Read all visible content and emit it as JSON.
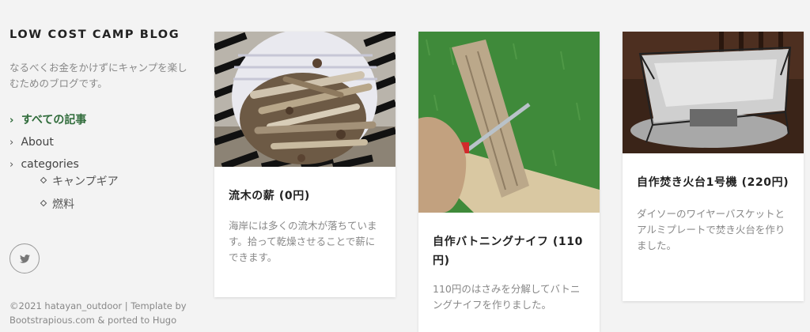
{
  "sidebar": {
    "site_title": "LOW COST CAMP BLOG",
    "description": "なるべくお金をかけずにキャンプを楽しむためのブログです。",
    "nav": {
      "all_posts": "すべての記事",
      "about": "About",
      "categories": "categories",
      "sub_items": [
        "キャンプギア",
        "燃料"
      ]
    },
    "social": {
      "icon": "twitter-icon"
    },
    "footer": {
      "line1": "©2021 hatayan_outdoor | Template by",
      "line2": "Bootstrapious.com & ported to Hugo"
    }
  },
  "colors": {
    "background": "#f3f3f3",
    "accent": "#2f6b3a",
    "card_bg": "#ffffff"
  },
  "cards": [
    {
      "title": "流木の薪 (0円)",
      "excerpt": "海岸には多くの流木が落ちています。拾って乾燥させることで薪にできます。"
    },
    {
      "title": "自作バトニングナイフ (110円)",
      "excerpt": "110円のはさみを分解してバトニングナイフを作りました。"
    },
    {
      "title": "自作焚き火台1号機 (220円)",
      "excerpt": "ダイソーのワイヤーバスケットとアルミプレートで焚き火台を作りました。"
    }
  ]
}
